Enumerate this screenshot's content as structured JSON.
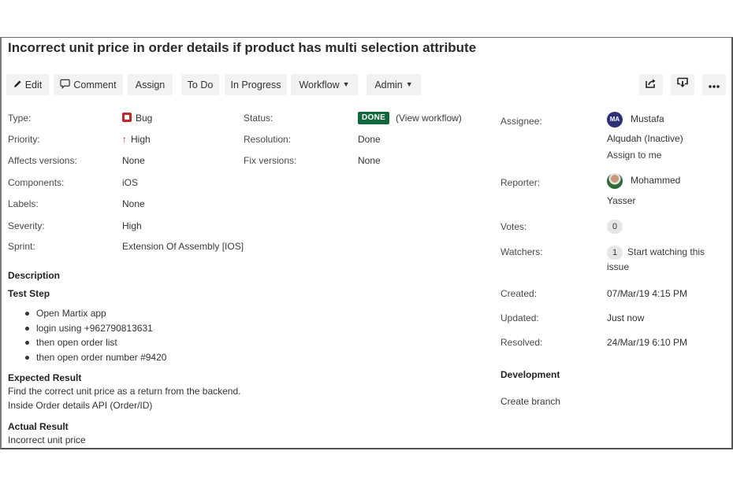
{
  "issue": {
    "title": "Incorrect unit price in order details if product has multi selection attribute"
  },
  "toolbar": {
    "edit": "Edit",
    "comment": "Comment",
    "assign": "Assign",
    "todo": "To Do",
    "in_progress": "In Progress",
    "workflow": "Workflow",
    "admin": "Admin",
    "share_icon": "share-icon",
    "export_icon": "export-icon",
    "more_icon": "more-icon"
  },
  "details": {
    "type_label": "Type:",
    "type_value": "Bug",
    "priority_label": "Priority:",
    "priority_value": "High",
    "affects_label": "Affects versions:",
    "affects_value": "None",
    "components_label": "Components:",
    "components_value": "iOS",
    "labels_label": "Labels:",
    "labels_value": "None",
    "severity_label": "Severity:",
    "severity_value": "High",
    "sprint_label": "Sprint:",
    "sprint_value": "Extension Of Assembly [IOS]",
    "status_label": "Status:",
    "status_value": "DONE",
    "status_color": "#14663c",
    "view_workflow": "(View workflow)",
    "resolution_label": "Resolution:",
    "resolution_value": "Done",
    "fix_label": "Fix versions:",
    "fix_value": "None"
  },
  "people": {
    "assignee_label": "Assignee:",
    "assignee_initials": "MA",
    "assignee_name_line1": "Mustafa",
    "assignee_name_line2": "Alqudah (Inactive)",
    "assign_to_me": "Assign to me",
    "reporter_label": "Reporter:",
    "reporter_name_line1": "Mohammed",
    "reporter_name_line2": "Yasser",
    "votes_label": "Votes:",
    "votes_count": "0",
    "watchers_label": "Watchers:",
    "watchers_count": "1",
    "start_watching_line1": "Start watching this",
    "start_watching_line2": "issue"
  },
  "dates": {
    "created_label": "Created:",
    "created_value": "07/Mar/19 4:15 PM",
    "updated_label": "Updated:",
    "updated_value": "Just now",
    "resolved_label": "Resolved:",
    "resolved_value": "24/Mar/19 6:10 PM"
  },
  "development": {
    "heading": "Development",
    "create_branch": "Create branch"
  },
  "description": {
    "heading": "Description",
    "test_step_heading": "Test Step",
    "steps": [
      "Open Martix app",
      "login using +962790813631",
      "then open order list",
      "then open order number #9420"
    ],
    "expected_heading": "Expected Result",
    "expected_line1": "Find the correct unit price as a return from the backend.",
    "expected_line2": "Inside Order details API (Order/ID)",
    "actual_heading": "Actual Result",
    "actual_line1": "Incorrect unit price"
  }
}
